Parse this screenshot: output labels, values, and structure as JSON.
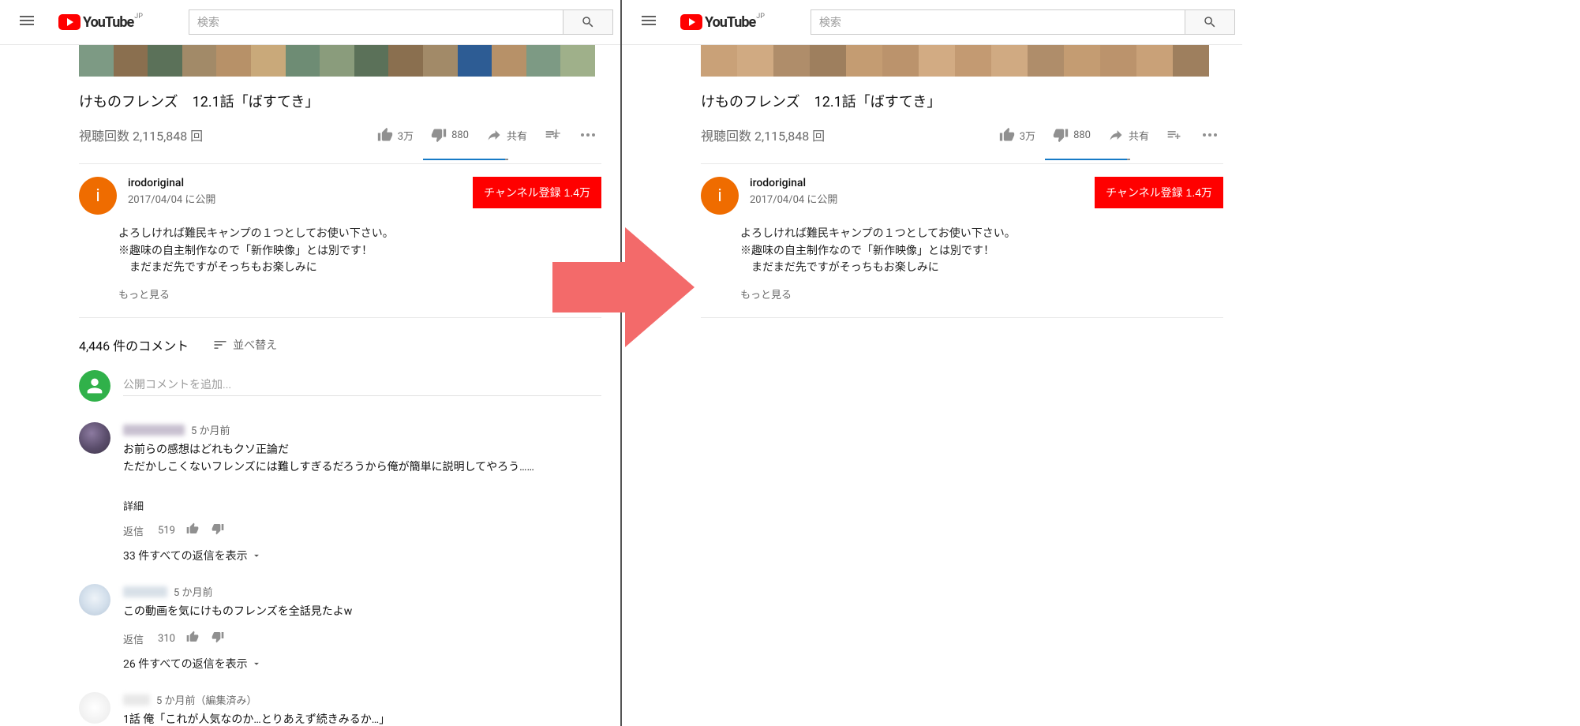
{
  "header": {
    "logo_text": "YouTube",
    "region": "JP",
    "search_placeholder": "検索"
  },
  "video": {
    "title": "けものフレンズ　12.1話「ばすてき」",
    "views": "視聴回数 2,115,848 回",
    "likes": "3万",
    "dislikes": "880",
    "share": "共有"
  },
  "channel": {
    "initial": "i",
    "name": "irodoriginal",
    "published": "2017/04/04 に公開",
    "subscribe": "チャンネル登録  1.4万"
  },
  "description": {
    "line1": "よろしければ難民キャンプの１つとしてお使い下さい。",
    "line2": "※趣味の自主制作なので「新作映像」とは別です！",
    "line3": "　まだまだ先ですがそっちもお楽しみに",
    "show_more": "もっと見る"
  },
  "comments_header": {
    "count": "4,446 件のコメント",
    "sort": "並べ替え",
    "add_placeholder": "公開コメントを追加..."
  },
  "comments": [
    {
      "date": "5 か月前",
      "line1": "お前らの感想はどれもクソ正論だ",
      "line2": "ただかしこくないフレンズには難しすぎるだろうから俺が簡単に説明してやろう……",
      "details": "詳細",
      "reply_label": "返信",
      "likes": "519",
      "view_replies": "33 件すべての返信を表示"
    },
    {
      "date": "5 か月前",
      "line1": "この動画を気にけものフレンズを全話見たよw",
      "reply_label": "返信",
      "likes": "310",
      "view_replies": "26 件すべての返信を表示"
    },
    {
      "date": "5 か月前（編集済み）",
      "line1": "1話 俺「これが人気なのか…とりあえず続きみるか…」"
    }
  ]
}
